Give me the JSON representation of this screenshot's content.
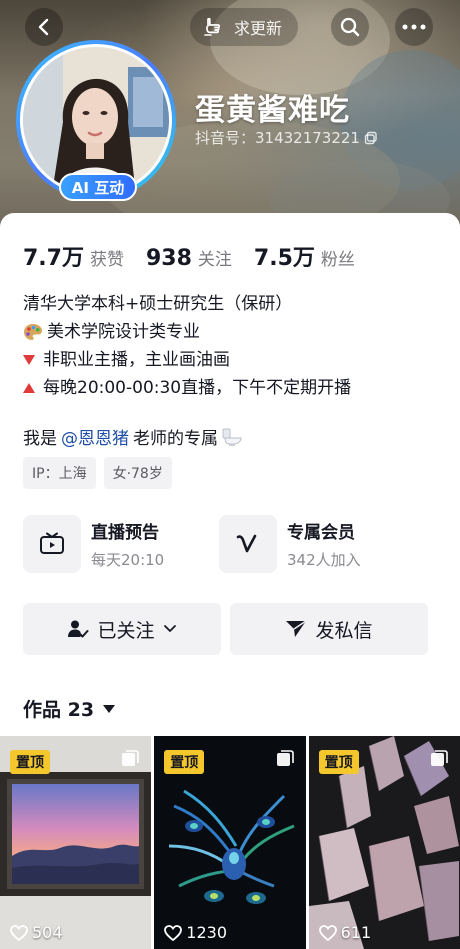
{
  "header": {
    "update_label": "求更新",
    "nickname": "蛋黄酱难吃",
    "douyin_id": "抖音号：31432173221",
    "ai_badge": "AI 互动"
  },
  "stats": [
    {
      "num": "7.7万",
      "label": "获赞"
    },
    {
      "num": "938",
      "label": "关注"
    },
    {
      "num": "7.5万",
      "label": "粉丝"
    }
  ],
  "bio": {
    "line1": "清华大学本科+硕士研究生（保研）",
    "line2": "美术学院设计类专业",
    "line3": "非职业主播，主业画油画",
    "line4": "每晚20:00-00:30直播，下午不定期开播"
  },
  "intro": {
    "prefix": "我是",
    "mention": "@恩恩猪",
    "suffix": "老师的专属"
  },
  "tags": [
    "IP：上海",
    "女·78岁"
  ],
  "services": [
    {
      "title": "直播预告",
      "sub": "每天20:10",
      "icon": "tv-icon"
    },
    {
      "title": "专属会员",
      "sub": "342人加入",
      "icon": "v-icon"
    }
  ],
  "actions": {
    "follow_label": "已关注",
    "message_label": "发私信"
  },
  "works": {
    "label": "作品 23"
  },
  "grid": [
    {
      "pin": "置顶",
      "likes": "504"
    },
    {
      "pin": "置顶",
      "likes": "1230"
    },
    {
      "pin": "置顶",
      "likes": "611"
    }
  ],
  "colors": {
    "accent_mention": "#1f4fa8",
    "pin_yellow": "#f4c82c",
    "ai_badge_blue": "#2f6cff",
    "bullet_red": "#e03a3a"
  }
}
